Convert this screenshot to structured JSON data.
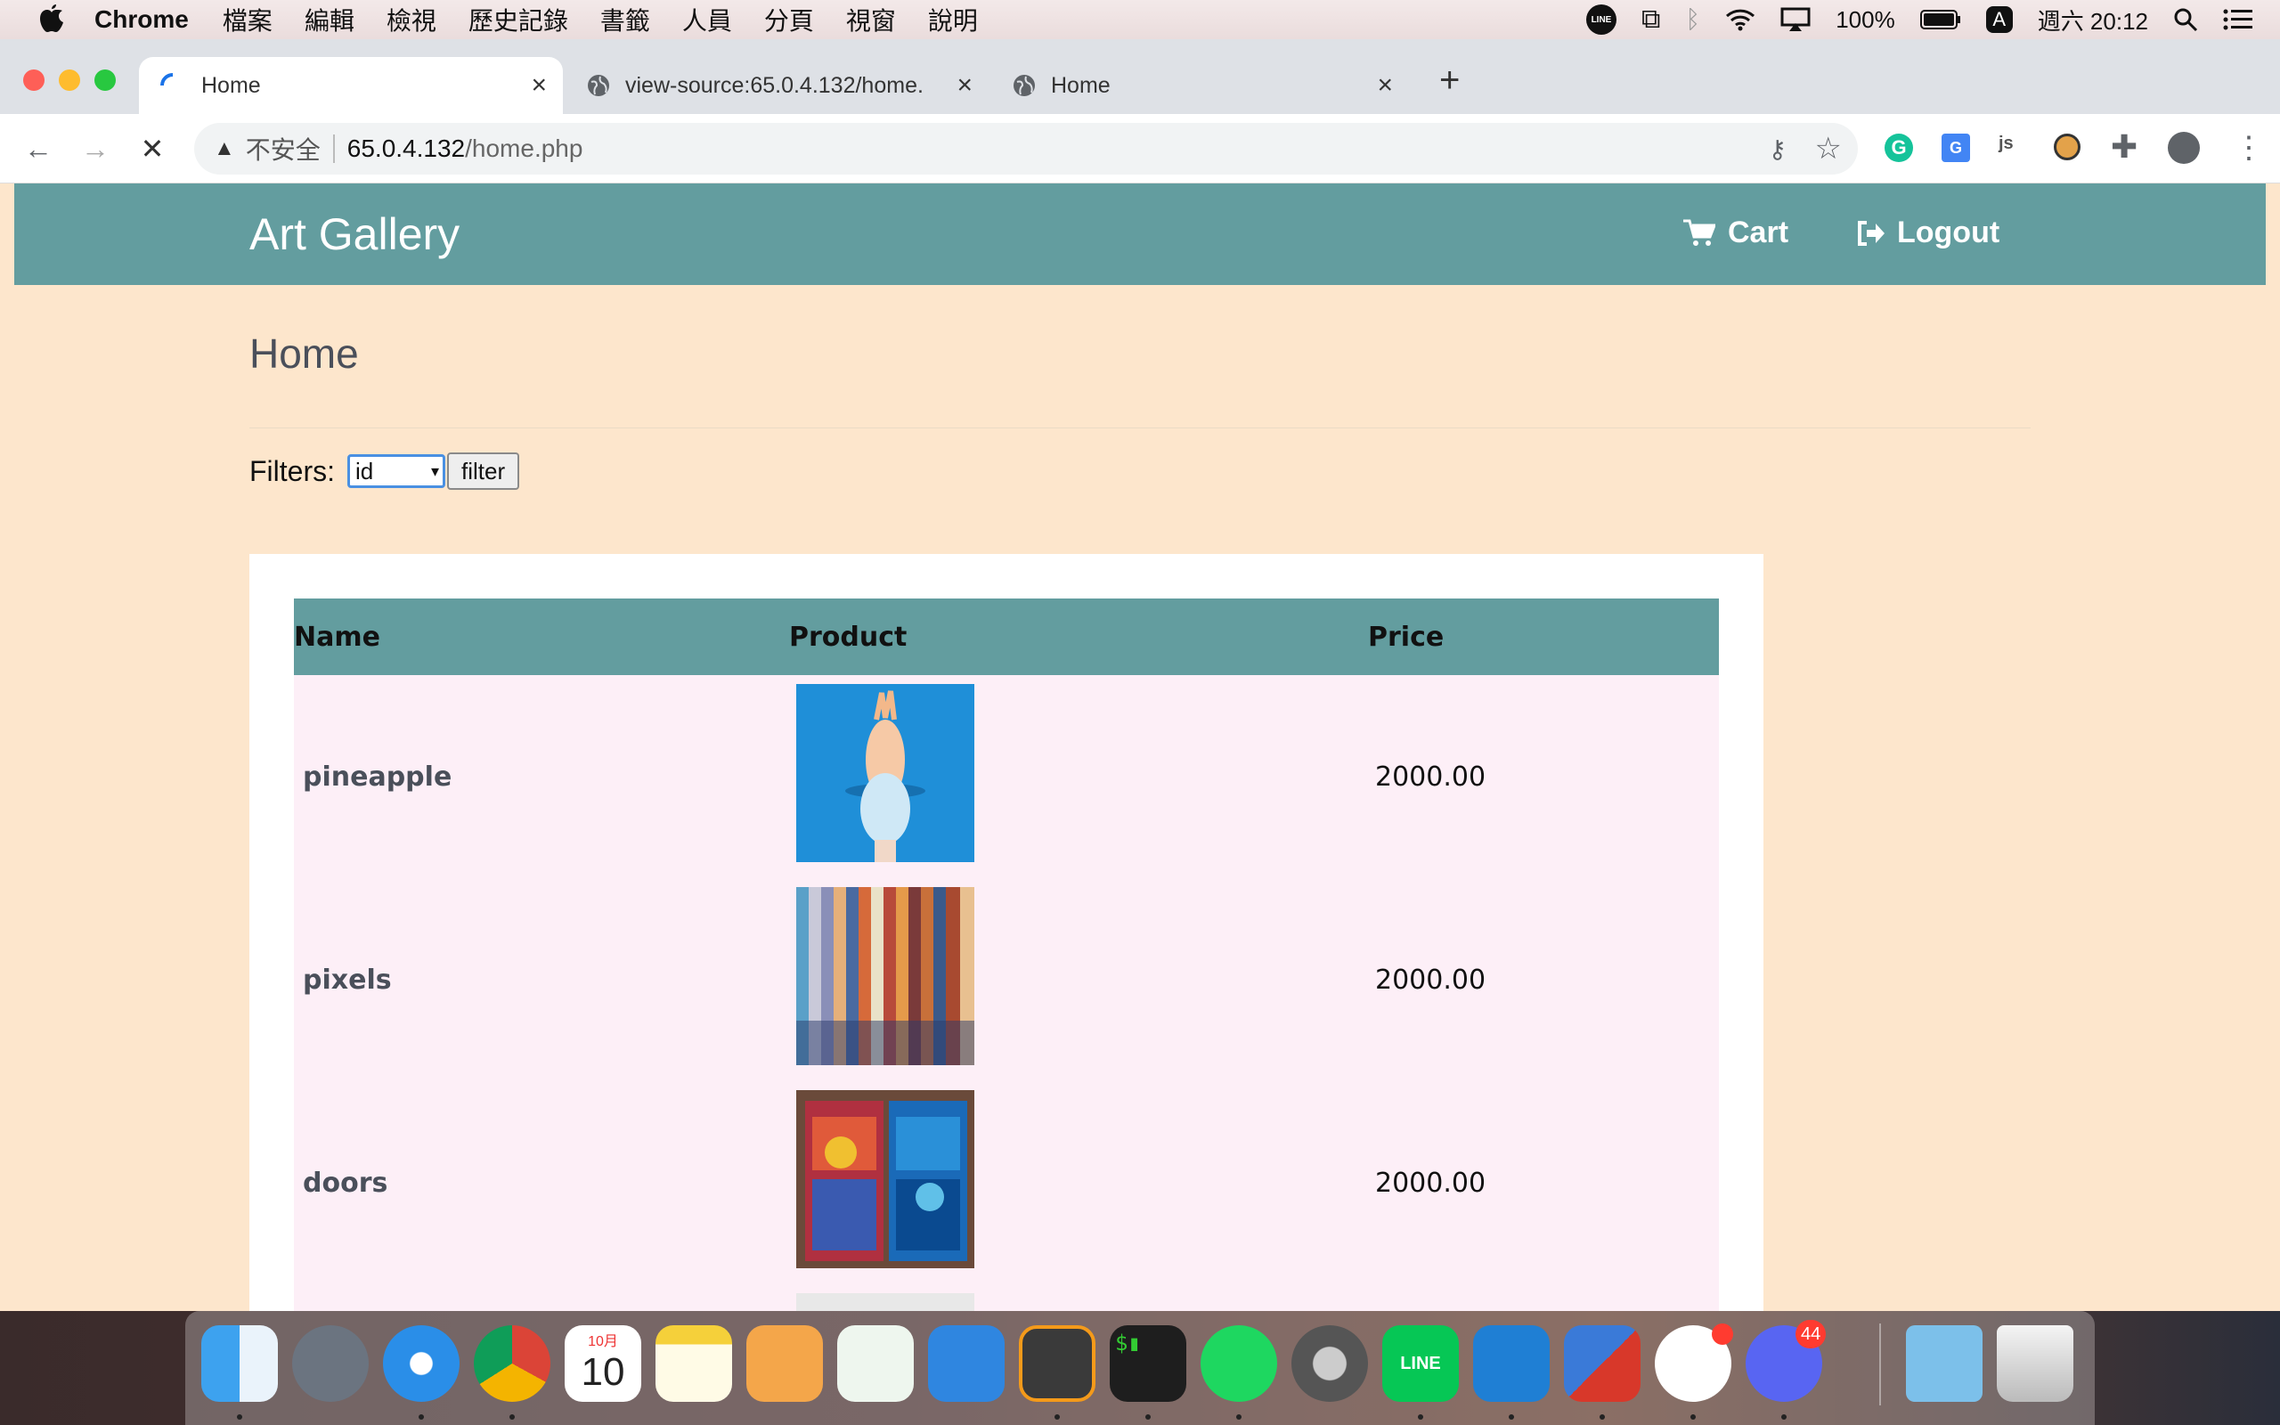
{
  "menubar": {
    "app_name": "Chrome",
    "items": [
      "檔案",
      "編輯",
      "檢視",
      "歷史記錄",
      "書籤",
      "人員",
      "分頁",
      "視窗",
      "說明"
    ],
    "battery": "100%",
    "input_method": "A",
    "clock": "週六 20:12"
  },
  "tabs": [
    {
      "title": "Home",
      "active": true
    },
    {
      "title": "view-source:65.0.4.132/home.",
      "active": false
    },
    {
      "title": "Home",
      "active": false
    }
  ],
  "omnibox": {
    "security": "不安全",
    "host": "65.0.4.132",
    "path": "/home.php"
  },
  "site": {
    "brand": "Art Gallery",
    "nav": {
      "cart": "Cart",
      "logout": "Logout"
    },
    "heading": "Home",
    "filters_label": "Filters:",
    "filter_value": "id",
    "filter_button": "filter",
    "table": {
      "headers": [
        "Name",
        "Product",
        "Price"
      ],
      "rows": [
        {
          "name": "pineapple",
          "price": "2000.00"
        },
        {
          "name": "pixels",
          "price": "2000.00"
        },
        {
          "name": "doors",
          "price": "2000.00"
        }
      ]
    }
  },
  "dock": {
    "calendar_month": "10月",
    "calendar_day": "10",
    "discord_badge": "44"
  },
  "colors": {
    "navbar": "#639d9f",
    "page_bg": "#fde6cc",
    "row_bg": "#fdeff7"
  }
}
